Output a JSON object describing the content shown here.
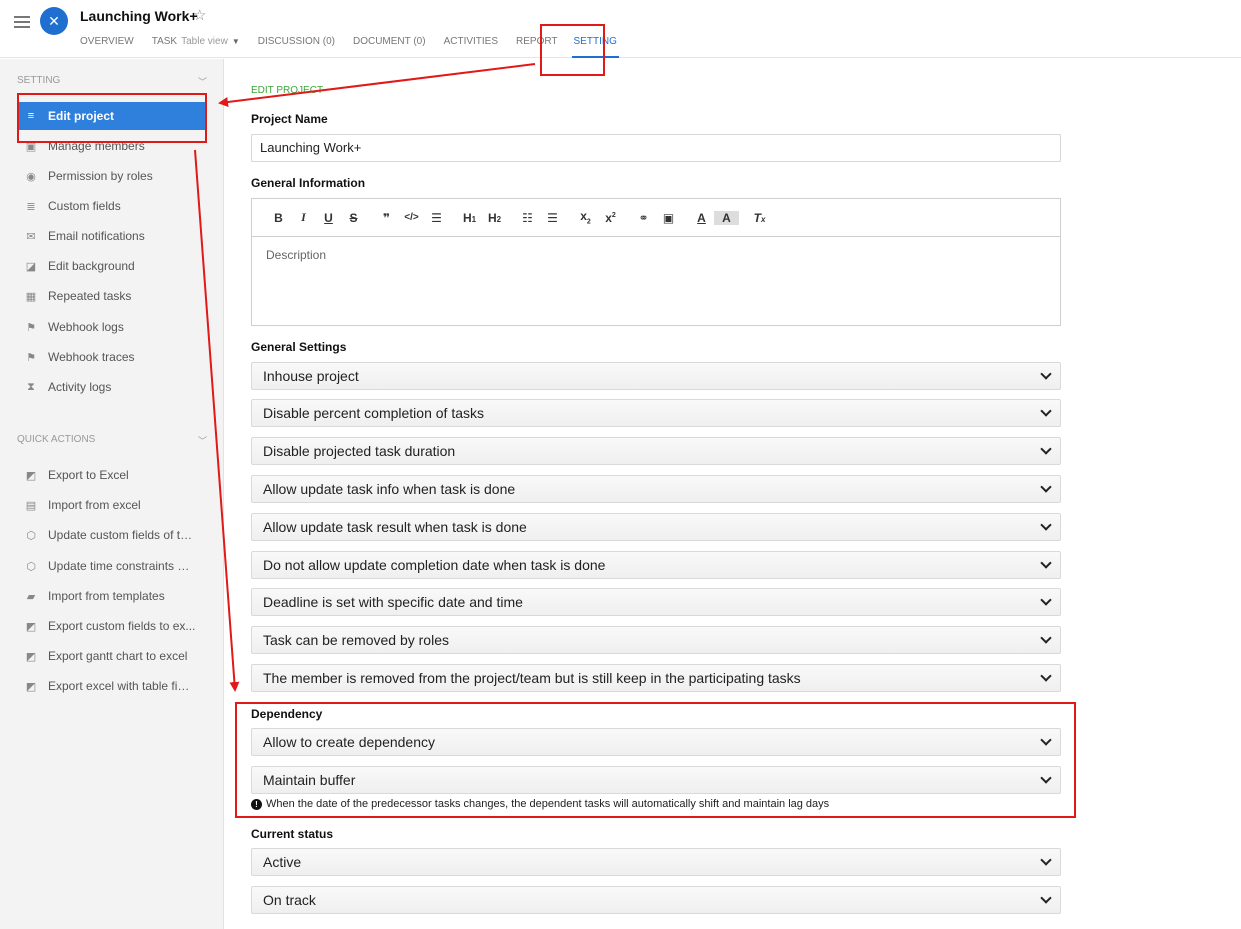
{
  "header": {
    "title": "Launching Work+",
    "tabs": [
      {
        "label": "OVERVIEW"
      },
      {
        "label": "TASK",
        "sub": "Table view"
      },
      {
        "label": "DISCUSSION (0)"
      },
      {
        "label": "DOCUMENT (0)"
      },
      {
        "label": "ACTIVITIES"
      },
      {
        "label": "REPORT"
      },
      {
        "label": "SETTING"
      }
    ]
  },
  "sidebar": {
    "setting_title": "SETTING",
    "setting_items": [
      {
        "label": "Edit project",
        "icon": "list-icon"
      },
      {
        "label": "Manage members",
        "icon": "member-icon"
      },
      {
        "label": "Permission by roles",
        "icon": "permission-icon"
      },
      {
        "label": "Custom fields",
        "icon": "database-icon"
      },
      {
        "label": "Email notifications",
        "icon": "mail-icon"
      },
      {
        "label": "Edit background",
        "icon": "image-icon"
      },
      {
        "label": "Repeated tasks",
        "icon": "calendar-icon"
      },
      {
        "label": "Webhook logs",
        "icon": "flag-icon"
      },
      {
        "label": "Webhook traces",
        "icon": "flag-icon"
      },
      {
        "label": "Activity logs",
        "icon": "hourglass-icon"
      }
    ],
    "quick_title": "QUICK ACTIONS",
    "quick_items": [
      {
        "label": "Export to Excel",
        "icon": "export-icon"
      },
      {
        "label": "Import from excel",
        "icon": "excel-file-icon"
      },
      {
        "label": "Update custom fields of ta...",
        "icon": "box-icon"
      },
      {
        "label": "Update time constraints of...",
        "icon": "box-icon"
      },
      {
        "label": "Import from templates",
        "icon": "folder-icon"
      },
      {
        "label": "Export custom fields to ex...",
        "icon": "export-icon"
      },
      {
        "label": "Export gantt chart to excel",
        "icon": "export-icon"
      },
      {
        "label": "Export excel with table fields",
        "icon": "export-icon"
      }
    ]
  },
  "main": {
    "breadcrumb": "EDIT PROJECT",
    "project_name_label": "Project Name",
    "project_name_value": "Launching Work+",
    "general_info_label": "General Information",
    "description_placeholder": "Description",
    "general_settings_label": "General Settings",
    "general_settings": [
      "Inhouse project",
      "Disable percent completion of tasks",
      "Disable projected task duration",
      "Allow update task info when task is done",
      "Allow update task result when task is done",
      "Do not allow update completion date when task is done",
      "Deadline is set with specific date and time",
      "Task can be removed by roles",
      "The member is removed from the project/team but is still keep in the participating tasks"
    ],
    "dependency_label": "Dependency",
    "dependency": [
      "Allow to create dependency",
      "Maintain buffer"
    ],
    "dependency_note": "When the date of the predecessor tasks changes, the dependent tasks will automatically shift and maintain lag days",
    "current_status_label": "Current status",
    "current_status": [
      "Active",
      "On track"
    ]
  },
  "colors": {
    "accent": "#1e6fcf",
    "annotation": "#e01919",
    "breadcrumb": "#3aa63a"
  }
}
